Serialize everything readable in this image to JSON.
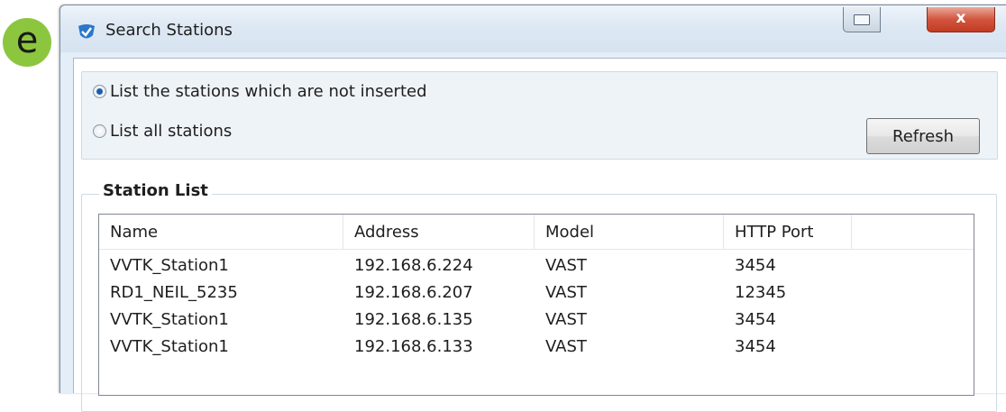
{
  "badge": {
    "letter": "e",
    "color": "#8cc63f"
  },
  "window": {
    "title": "Search Stations",
    "app_icon": "shield-check-icon",
    "controls": {
      "restore_icon": "restore-icon",
      "close_label": "x"
    }
  },
  "options": {
    "radio_not_inserted": {
      "label": "List the stations which are not inserted",
      "checked": true
    },
    "radio_all": {
      "label": "List all stations",
      "checked": false
    },
    "refresh_label": "Refresh"
  },
  "station_list": {
    "label": "Station List",
    "columns": [
      "Name",
      "Address",
      "Model",
      "HTTP Port"
    ],
    "rows": [
      [
        "VVTK_Station1",
        "192.168.6.224",
        "VAST",
        "3454"
      ],
      [
        "RD1_NEIL_5235",
        "192.168.6.207",
        "VAST",
        "12345"
      ],
      [
        "VVTK_Station1",
        "192.168.6.135",
        "VAST",
        "3454"
      ],
      [
        "VVTK_Station1",
        "192.168.6.133",
        "VAST",
        "3454"
      ]
    ]
  }
}
